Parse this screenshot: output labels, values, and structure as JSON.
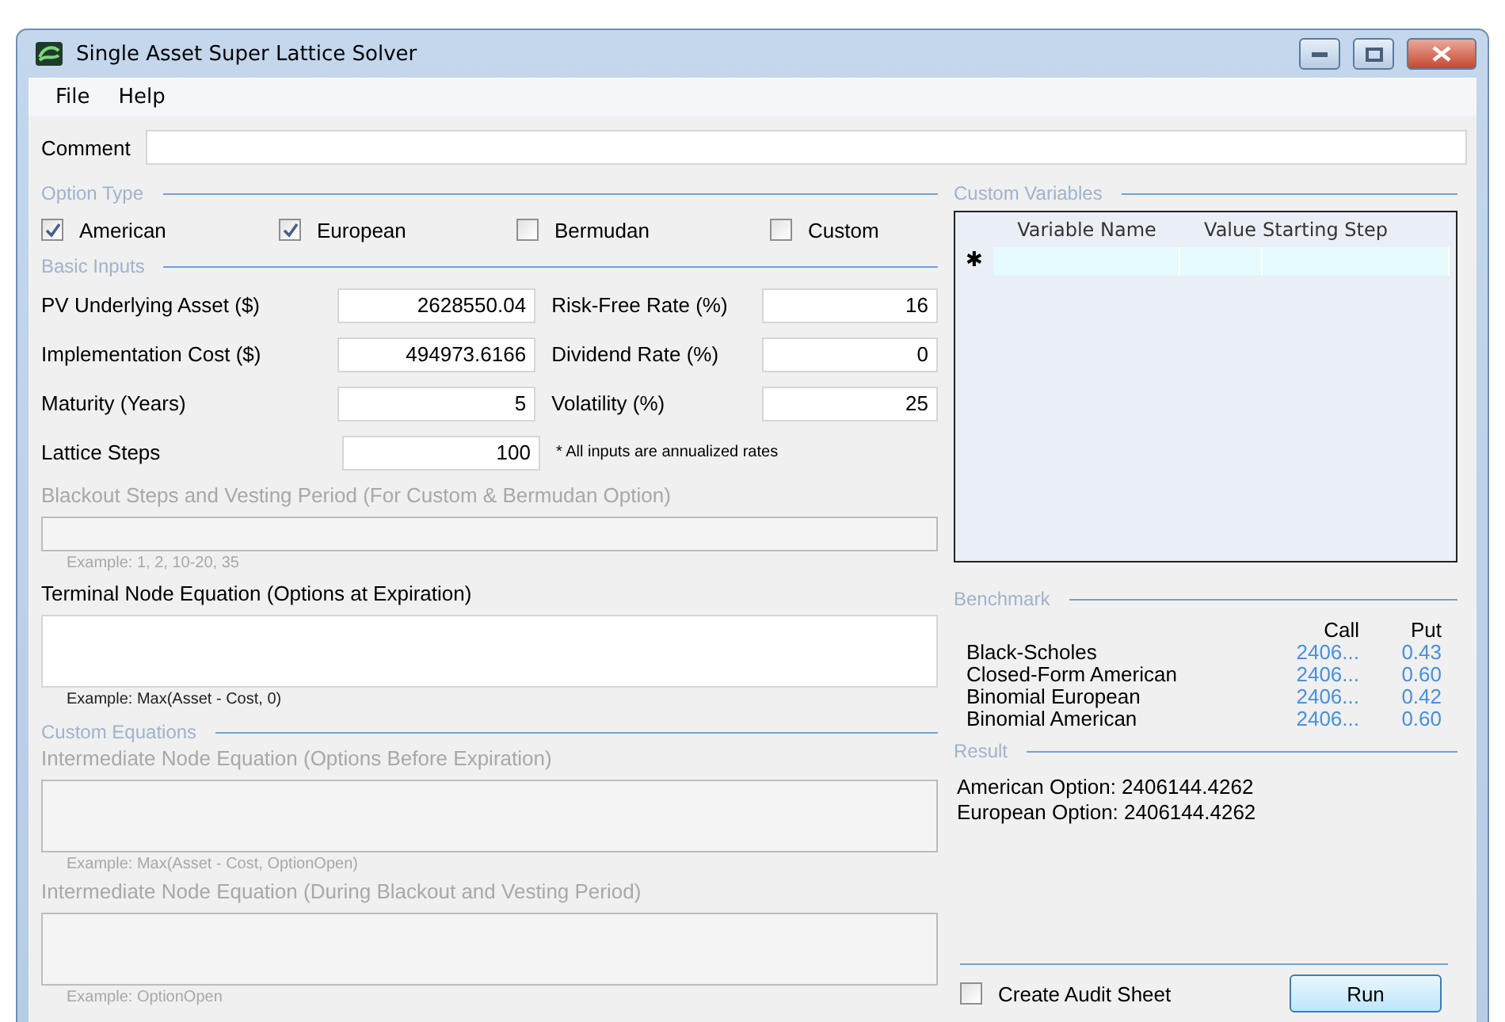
{
  "window": {
    "title": "Single Asset Super Lattice Solver"
  },
  "menu": [
    {
      "label": "File"
    },
    {
      "label": "Help"
    }
  ],
  "comment": {
    "label": "Comment"
  },
  "option_type": {
    "title": "Option Type",
    "options": [
      {
        "label": "American",
        "checked": true
      },
      {
        "label": "European",
        "checked": true
      },
      {
        "label": "Bermudan",
        "checked": false
      },
      {
        "label": "Custom",
        "checked": false
      }
    ]
  },
  "basic_inputs": {
    "title": "Basic Inputs",
    "rows": [
      {
        "left": {
          "label": "PV Underlying Asset ($)",
          "value": "2628550.04"
        },
        "right": {
          "kind": "field",
          "label": "Risk-Free Rate (%)",
          "value": "16"
        }
      },
      {
        "left": {
          "label": "Implementation Cost ($)",
          "value": "494973.6166"
        },
        "right": {
          "kind": "field",
          "label": "Dividend Rate (%)",
          "value": "0"
        }
      },
      {
        "left": {
          "label": "Maturity (Years)",
          "value": "5"
        },
        "right": {
          "kind": "field",
          "label": "Volatility (%)",
          "value": "25"
        }
      },
      {
        "left": {
          "label": "Lattice Steps",
          "value": "100"
        },
        "right": {
          "kind": "note",
          "label": "* All inputs are annualized rates"
        }
      }
    ]
  },
  "blackout": {
    "label": "Blackout Steps and Vesting Period (For Custom & Bermudan Option)",
    "example": "Example: 1, 2, 10-20, 35",
    "disabled": true
  },
  "terminal": {
    "label": "Terminal Node Equation (Options at Expiration)",
    "example": "Example: Max(Asset - Cost, 0)",
    "disabled": false
  },
  "custom_equations": {
    "title": "Custom Equations",
    "equations": [
      {
        "label": "Intermediate Node Equation (Options Before Expiration)",
        "example": "Example: Max(Asset - Cost, OptionOpen)",
        "disabled": true
      },
      {
        "label": "Intermediate Node Equation (During Blackout and Vesting Period)",
        "example": "Example: OptionOpen",
        "disabled": true
      }
    ]
  },
  "custom_variables": {
    "title": "Custom Variables",
    "columns": [
      "Variable Name",
      "Value",
      "Starting Step"
    ],
    "new_row_marker": "✱"
  },
  "benchmark": {
    "title": "Benchmark",
    "columns": [
      "Call",
      "Put"
    ],
    "rows": [
      {
        "name": "Black-Scholes",
        "call": "2406...",
        "put": "0.43"
      },
      {
        "name": "Closed-Form American",
        "call": "2406...",
        "put": "0.60"
      },
      {
        "name": "Binomial European",
        "call": "2406...",
        "put": "0.42"
      },
      {
        "name": "Binomial American",
        "call": "2406...",
        "put": "0.60"
      }
    ]
  },
  "result": {
    "title": "Result",
    "lines": [
      "American Option: 2406144.4262",
      "European Option: 2406144.4262"
    ]
  },
  "audit": {
    "label": "Create Audit Sheet",
    "checked": false
  },
  "run_button": {
    "label": "Run"
  }
}
